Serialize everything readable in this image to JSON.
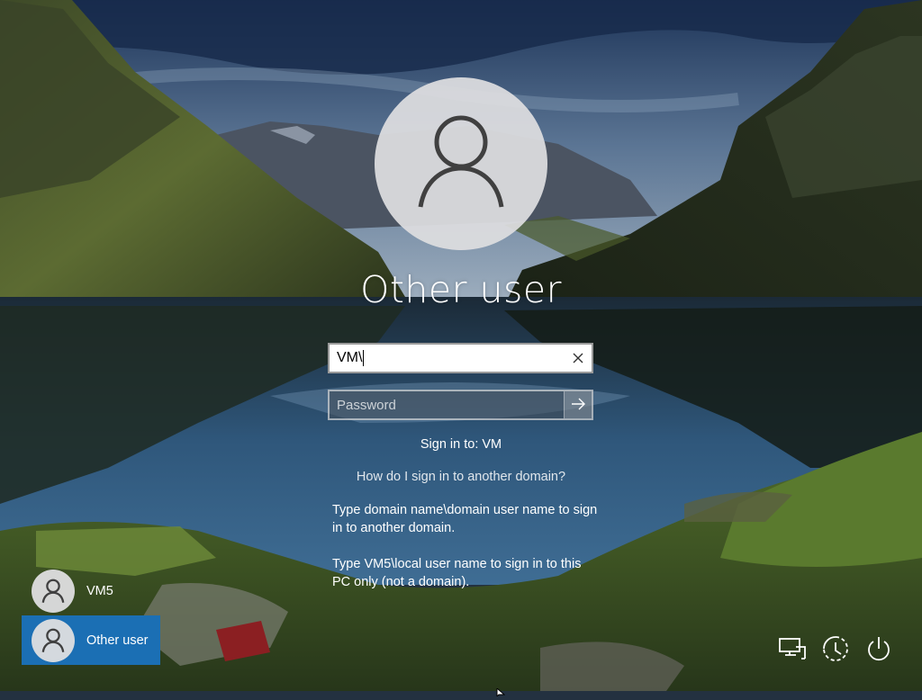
{
  "screen": {
    "title": "Other user",
    "username_value": "VM\\",
    "password_placeholder": "Password",
    "sign_in_to": "Sign in to: VM",
    "help_link": "How do I sign in to another domain?",
    "help_text_1": "Type domain name\\domain user name to sign in to another domain.",
    "help_text_2": "Type VM5\\local user name to sign in to this PC only (not a domain)."
  },
  "users": [
    {
      "label": "VM5",
      "selected": false
    },
    {
      "label": "Other user",
      "selected": true
    }
  ],
  "icons": {
    "avatar": "user-silhouette-icon",
    "clear": "close-icon",
    "submit": "arrow-right-icon",
    "network": "network-icon",
    "ease_of_access": "ease-of-access-icon",
    "power": "power-icon"
  },
  "colors": {
    "selected_tile": "#1b6fb4",
    "avatar_bg": "#dedee0"
  }
}
